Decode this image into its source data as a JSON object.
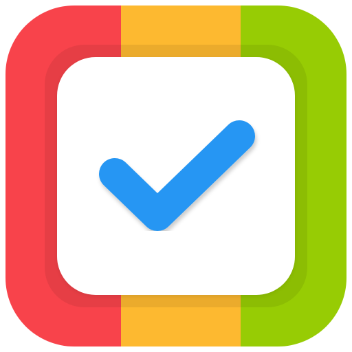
{
  "app_icon": {
    "name": "checklist-app-icon",
    "colors": {
      "red": "#F8434B",
      "yellow": "#FDB930",
      "green": "#97CC04",
      "card": "#FFFFFF",
      "check": "#2696F3"
    },
    "icon": "checkmark-icon"
  }
}
